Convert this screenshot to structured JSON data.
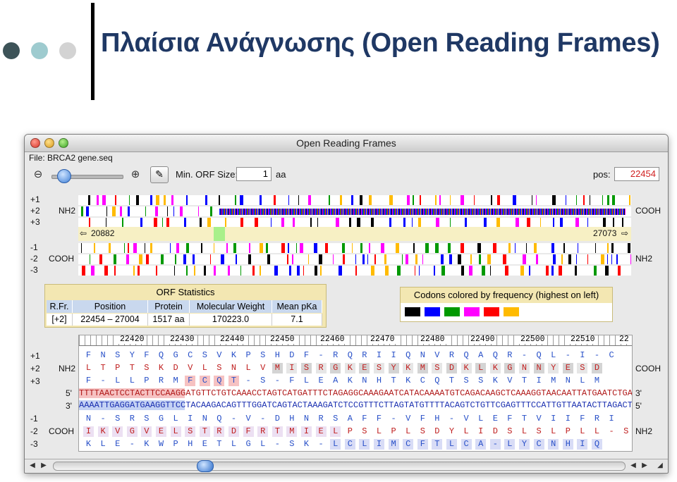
{
  "slide": {
    "title": "Πλαίσια Ανάγνωσης (Open Reading Frames)",
    "bullet_colors": [
      "#3d5358",
      "#9ecbcf",
      "#d3d3d3"
    ]
  },
  "window": {
    "title": "Open Reading Frames",
    "file_label": "File: BRCA2 gene.seq",
    "min_orf_label": "Min. ORF Size:",
    "min_orf_value": "1",
    "min_orf_unit": "aa",
    "pos_label": "pos:",
    "pos_value": "22454"
  },
  "overview": {
    "frame_labels": [
      "+1",
      "+2",
      "+3",
      "-1",
      "-2",
      "-3"
    ],
    "top_left_terminus": "NH2",
    "top_right_terminus": "COOH",
    "bottom_left_terminus": "COOH",
    "bottom_right_terminus": "NH2",
    "range_start": "20882",
    "range_end": "27073"
  },
  "stats": {
    "title": "ORF Statistics",
    "headers": [
      "R.Fr.",
      "Position",
      "Protein",
      "Molecular Weight",
      "Mean pKa"
    ],
    "row": [
      "[+2]",
      "22454 – 27004",
      "1517 aa",
      "170223.0",
      "7.1"
    ]
  },
  "legend": {
    "title": "Codons colored by frequency (highest on left)",
    "colors": [
      "#000000",
      "#0000ff",
      "#009900",
      "#ff00ff",
      "#ff0000",
      "#ffbb00"
    ]
  },
  "sequence": {
    "ruler_labels": [
      "22420",
      "22430",
      "22440",
      "22450",
      "22460",
      "22470",
      "22480",
      "22490",
      "22500",
      "22510",
      "22"
    ],
    "frame_labels": [
      "+1",
      "+2",
      "+3",
      "5'",
      "3'",
      "-1",
      "-2",
      "-3"
    ],
    "top_terminus_left": "NH2",
    "top_terminus_right": "COOH",
    "bottom_terminus_left": "COOH",
    "bottom_terminus_right": "NH2",
    "right_end_5": "3'",
    "right_end_3": "5'",
    "aa_plus1": "F N S Y F Q G C S V K P S H D F - R Q R I I Q N V R Q A Q R - Q L - I - C",
    "aa_plus2": "L T P T S K D V L S N L V M I S R G K E S Y K M S D K L K G N N Y E S D",
    "aa_plus3": "F - L L P R M F C Q T - S - F L E A K N H T K C Q T S S K V T I M N L M",
    "dna_top": "TTTTAACTCCTACTTCCAAGGATGTTCTGTCAAACCTAGTCATGATTTCTAGAGGCAAAGAATCATACAAAATGTCAGACAAGCTCAAAGGTAACAATTATGAATCTGAT",
    "dna_bottom": "AAAATTGAGGATGAAGGTTCCTACAAGACAGTTTGGATCAGTACTAAAGATCTCCGTTTCTTAGTATGTTTTACAGTCTGTTCGAGTTTCCATTGTTAATACTTAGACTA",
    "aa_minus1": "N - S R S G L I N Q - V - D H N R S A F F - V F H - V L E F T V I I F R I",
    "aa_minus2": "I K V G V E L S T R D F R T M I E L P S L P L S D Y L I D S L S L P L L - S D S",
    "aa_minus3": "K L E - K W P H E T L G L - S K - L C L I M C F T L C A - L Y C N H I Q"
  }
}
